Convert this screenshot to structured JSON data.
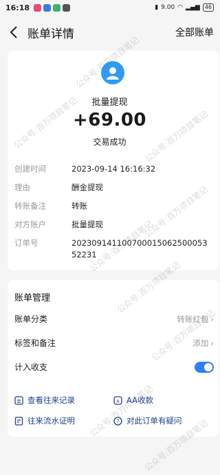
{
  "status_bar": {
    "time": "16:18",
    "speed": "9.00",
    "battery": "46"
  },
  "nav": {
    "title": "账单详情",
    "right_action": "全部账单"
  },
  "summary": {
    "title": "批量提现",
    "amount": "+69.00",
    "status": "交易成功"
  },
  "details": [
    {
      "label": "创建时间",
      "value": "2023-09-14 16:16:32"
    },
    {
      "label": "理由",
      "value": "酬金提现"
    },
    {
      "label": "转账备注",
      "value": "转账"
    },
    {
      "label": "对方账户",
      "value": "批量提现"
    },
    {
      "label": "订单号",
      "value": "20230914110070001506250005352231"
    }
  ],
  "management": {
    "title": "账单管理",
    "category_label": "账单分类",
    "category_value": "转账红包",
    "tags_label": "标签和备注",
    "tags_value": "添加",
    "count_label": "计入收支",
    "count_enabled": true
  },
  "links": {
    "history": "查看往来记录",
    "aa": "AA收款",
    "proof": "往来流水证明",
    "question": "对此订单有疑问"
  },
  "watermark": "公众号:百万项目笔记",
  "colors": {
    "accent": "#2f7ef4",
    "link": "#1d3f8f"
  }
}
